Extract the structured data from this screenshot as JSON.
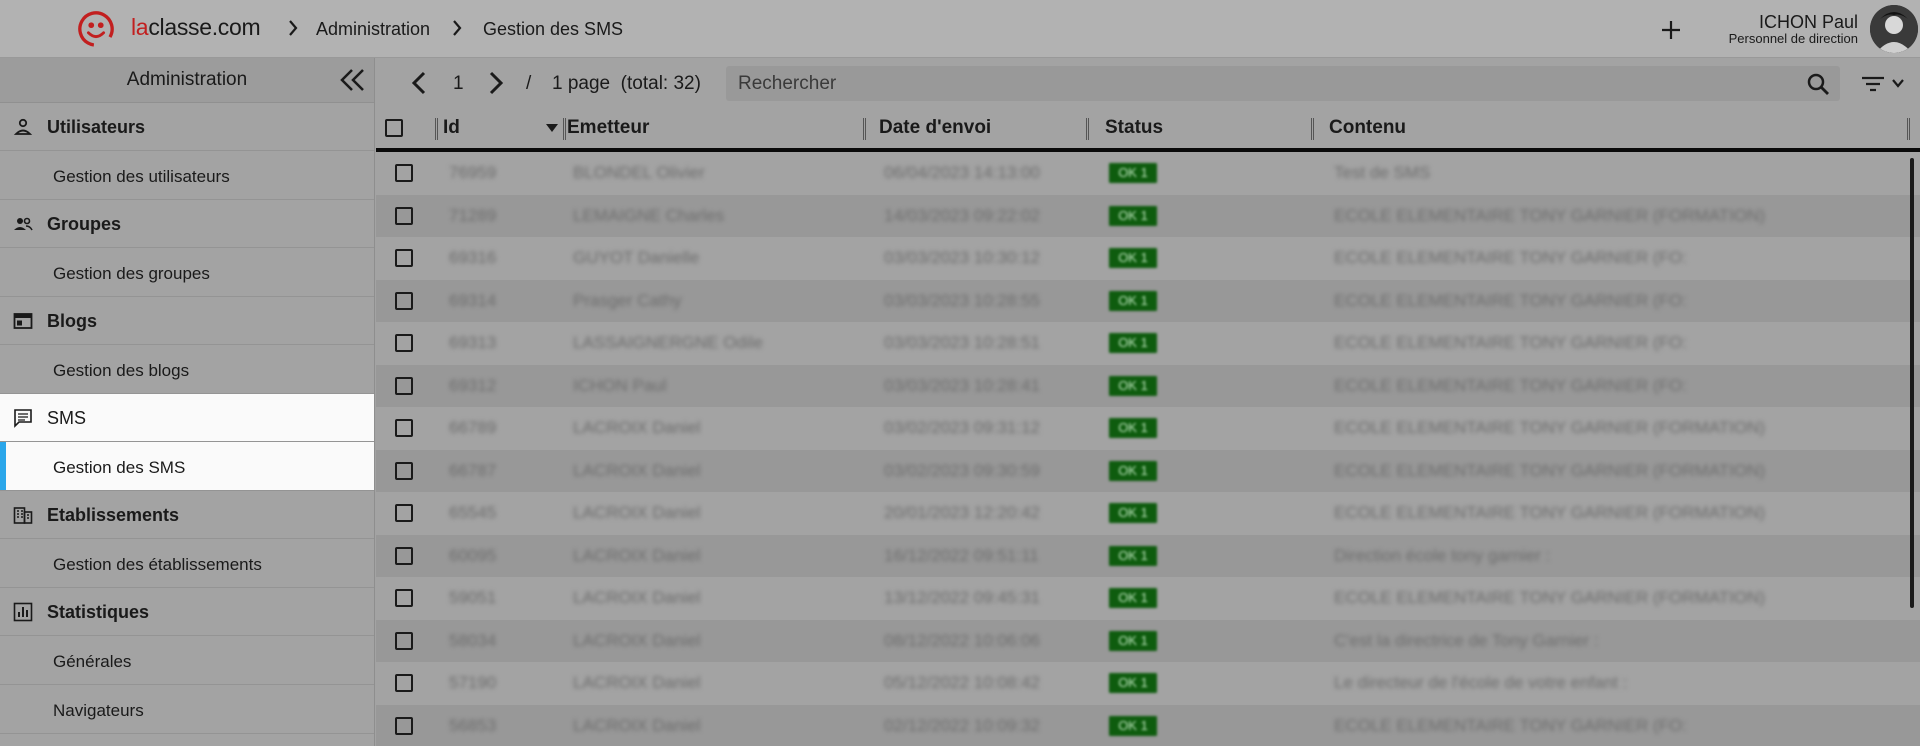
{
  "header": {
    "logo_text_la": "la",
    "logo_text_rest": "classe.com",
    "breadcrumb": [
      "Administration",
      "Gestion des SMS"
    ],
    "user_name": "ICHON Paul",
    "user_role": "Personnel de direction"
  },
  "sidebar": {
    "title": "Administration",
    "sections": [
      {
        "label": "Utilisateurs",
        "icon": "person-icon",
        "items": [
          "Gestion des utilisateurs"
        ]
      },
      {
        "label": "Groupes",
        "icon": "group-icon",
        "items": [
          "Gestion des groupes"
        ]
      },
      {
        "label": "Blogs",
        "icon": "blog-icon",
        "items": [
          "Gestion des blogs"
        ]
      },
      {
        "label": "SMS",
        "icon": "message-icon",
        "items": [
          "Gestion des SMS"
        ],
        "active": true
      },
      {
        "label": "Etablissements",
        "icon": "building-icon",
        "items": [
          "Gestion des établissements"
        ]
      },
      {
        "label": "Statistiques",
        "icon": "chart-icon",
        "items": [
          "Générales",
          "Navigateurs"
        ]
      }
    ]
  },
  "toolbar": {
    "page_number": "1",
    "slash": "/",
    "page_info": "1 page  (total: 32)",
    "search_placeholder": "Rechercher"
  },
  "table": {
    "headers": [
      "Id",
      "Emetteur",
      "Date d'envoi",
      "Status",
      "Contenu"
    ],
    "rows": [
      {
        "id": "76959",
        "sender": "BLONDEL Olivier",
        "date": "06/04/2023 14:13:00",
        "status": "OK 1",
        "content": "Test de SMS"
      },
      {
        "id": "71289",
        "sender": "LEMAIGNE Charles",
        "date": "14/03/2023 09:22:02",
        "status": "OK 1",
        "content": "ECOLE ELEMENTAIRE TONY GARNIER (FORMATION)"
      },
      {
        "id": "69316",
        "sender": "GUYOT Danielle",
        "date": "03/03/2023 10:30:12",
        "status": "OK 1",
        "content": "ECOLE ELEMENTAIRE TONY GARNIER (FO:"
      },
      {
        "id": "69314",
        "sender": "Prasger Cathy",
        "date": "03/03/2023 10:28:55",
        "status": "OK 1",
        "content": "ECOLE ELEMENTAIRE TONY GARNIER (FO:"
      },
      {
        "id": "69313",
        "sender": "LASSAIGNERGNE Odile",
        "date": "03/03/2023 10:28:51",
        "status": "OK 1",
        "content": "ECOLE ELEMENTAIRE TONY GARNIER (FO:"
      },
      {
        "id": "69312",
        "sender": "ICHON Paul",
        "date": "03/03/2023 10:28:41",
        "status": "OK 1",
        "content": "ECOLE ELEMENTAIRE TONY GARNIER (FO:"
      },
      {
        "id": "66789",
        "sender": "LACROIX Daniel",
        "date": "03/02/2023 09:31:12",
        "status": "OK 1",
        "content": "ECOLE ELEMENTAIRE TONY GARNIER (FORMATION)"
      },
      {
        "id": "66787",
        "sender": "LACROIX Daniel",
        "date": "03/02/2023 09:30:59",
        "status": "OK 1",
        "content": "ECOLE ELEMENTAIRE TONY GARNIER (FORMATION)"
      },
      {
        "id": "65545",
        "sender": "LACROIX Daniel",
        "date": "20/01/2023 12:20:42",
        "status": "OK 1",
        "content": "ECOLE ELEMENTAIRE TONY GARNIER (FORMATION)"
      },
      {
        "id": "60095",
        "sender": "LACROIX Daniel",
        "date": "16/12/2022 09:51:11",
        "status": "OK 1",
        "content": "Direction école tony garnier :"
      },
      {
        "id": "59051",
        "sender": "LACROIX Daniel",
        "date": "13/12/2022 09:45:31",
        "status": "OK 1",
        "content": "ECOLE ELEMENTAIRE TONY GARNIER (FORMATION)"
      },
      {
        "id": "58034",
        "sender": "LACROIX Daniel",
        "date": "08/12/2022 10:06:06",
        "status": "OK 1",
        "content": "C'est la directrice de Tony Garnier :"
      },
      {
        "id": "57190",
        "sender": "LACROIX Daniel",
        "date": "05/12/2022 10:08:42",
        "status": "OK 1",
        "content": "Le directeur de l'école de votre enfant :"
      },
      {
        "id": "56853",
        "sender": "LACROIX Daniel",
        "date": "02/12/2022 10:09:32",
        "status": "OK 1",
        "content": "ECOLE ELEMENTAIRE TONY GARNIER (FO:"
      }
    ]
  },
  "colors": {
    "brand_red": "#c21f1f",
    "active_indicator": "#2aa6ea",
    "status_ok": "#0e5c0e"
  }
}
